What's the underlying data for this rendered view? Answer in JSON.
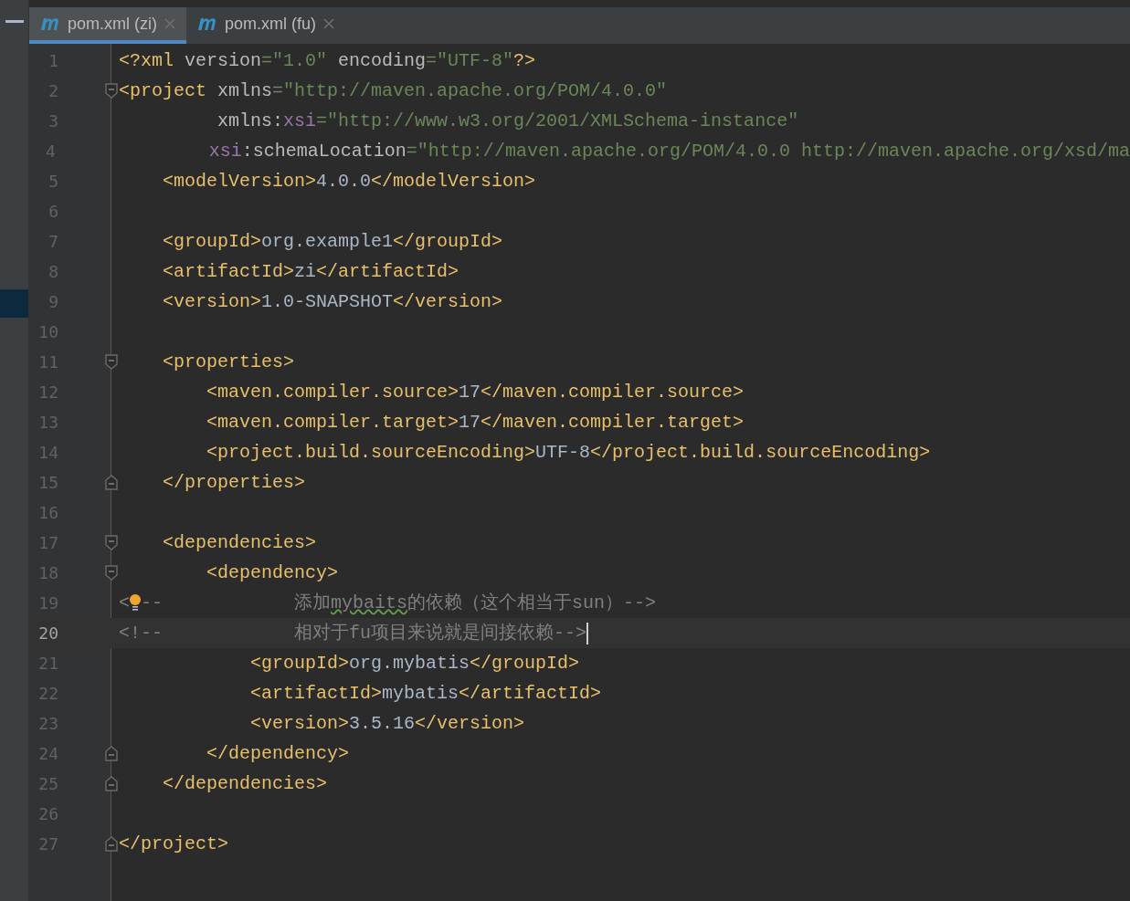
{
  "tabs": [
    {
      "label": "pom.xml (zi)",
      "selected": true
    },
    {
      "label": "pom.xml (fu)",
      "selected": false
    }
  ],
  "editor": {
    "lines": [
      {
        "number": "1",
        "current": false,
        "fold_start": false,
        "fold_end": false,
        "tokens": [
          {
            "t": "<?xml ",
            "kind": "tag"
          },
          {
            "t": "version",
            "kind": "attr"
          },
          {
            "t": "=\"1.0\" ",
            "kind": "string"
          },
          {
            "t": "encoding",
            "kind": "attr"
          },
          {
            "t": "=\"UTF-8\"",
            "kind": "string"
          },
          {
            "t": "?>",
            "kind": "tag"
          }
        ]
      },
      {
        "number": "2",
        "current": false,
        "fold_start": true,
        "fold_end": false,
        "tokens": [
          {
            "t": "<project ",
            "kind": "tag"
          },
          {
            "t": "xmlns",
            "kind": "attr"
          },
          {
            "t": "=\"http://maven.apache.org/POM/4.0.0\"",
            "kind": "string"
          }
        ]
      },
      {
        "number": "3",
        "current": false,
        "fold_start": false,
        "fold_end": false,
        "tokens": [
          {
            "t": "         xmlns:",
            "kind": "attr"
          },
          {
            "t": "xsi",
            "kind": "ns"
          },
          {
            "t": "=\"http://www.w3.org/2001/XMLSchema-instance\"",
            "kind": "string"
          }
        ]
      },
      {
        "number": "4",
        "current": false,
        "fold_start": false,
        "fold_end": false,
        "tokens": [
          {
            "t": "         xsi",
            "kind": "ns"
          },
          {
            "t": ":schemaLocation",
            "kind": "attr"
          },
          {
            "t": "=\"http://maven.apache.org/POM/4.0.0 http://maven.apache.org/xsd/ma",
            "kind": "string"
          }
        ]
      },
      {
        "number": "5",
        "current": false,
        "fold_start": false,
        "fold_end": false,
        "tokens": [
          {
            "t": "    <modelVersion>",
            "kind": "tag"
          },
          {
            "t": "4.0.0",
            "kind": "text"
          },
          {
            "t": "</modelVersion>",
            "kind": "tag"
          }
        ]
      },
      {
        "number": "6",
        "current": false,
        "fold_start": false,
        "fold_end": false
      },
      {
        "number": "7",
        "current": false,
        "fold_start": false,
        "fold_end": false,
        "tokens": [
          {
            "t": "    <groupId>",
            "kind": "tag"
          },
          {
            "t": "org.example1",
            "kind": "text"
          },
          {
            "t": "</groupId>",
            "kind": "tag"
          }
        ]
      },
      {
        "number": "8",
        "current": false,
        "fold_start": false,
        "fold_end": false,
        "tokens": [
          {
            "t": "    <artifactId>",
            "kind": "tag"
          },
          {
            "t": "zi",
            "kind": "text"
          },
          {
            "t": "</artifactId>",
            "kind": "tag"
          }
        ]
      },
      {
        "number": "9",
        "current": false,
        "fold_start": false,
        "fold_end": false,
        "tokens": [
          {
            "t": "    <version>",
            "kind": "tag"
          },
          {
            "t": "1.0-SNAPSHOT",
            "kind": "text"
          },
          {
            "t": "</version>",
            "kind": "tag"
          }
        ]
      },
      {
        "number": "10",
        "current": false,
        "fold_start": false,
        "fold_end": false
      },
      {
        "number": "11",
        "current": false,
        "fold_start": true,
        "fold_end": false,
        "tokens": [
          {
            "t": "    <properties>",
            "kind": "tag"
          }
        ]
      },
      {
        "number": "12",
        "current": false,
        "fold_start": false,
        "fold_end": false,
        "tokens": [
          {
            "t": "        <maven.compiler.source>",
            "kind": "tag"
          },
          {
            "t": "17",
            "kind": "text"
          },
          {
            "t": "</maven.compiler.source>",
            "kind": "tag"
          }
        ]
      },
      {
        "number": "13",
        "current": false,
        "fold_start": false,
        "fold_end": false,
        "tokens": [
          {
            "t": "        <maven.compiler.target>",
            "kind": "tag"
          },
          {
            "t": "17",
            "kind": "text"
          },
          {
            "t": "</maven.compiler.target>",
            "kind": "tag"
          }
        ]
      },
      {
        "number": "14",
        "current": false,
        "fold_start": false,
        "fold_end": false,
        "tokens": [
          {
            "t": "        <project.build.sourceEncoding>",
            "kind": "tag"
          },
          {
            "t": "UTF-8",
            "kind": "text"
          },
          {
            "t": "</project.build.sourceEncoding>",
            "kind": "tag"
          }
        ]
      },
      {
        "number": "15",
        "current": false,
        "fold_start": false,
        "fold_end": true,
        "tokens": [
          {
            "t": "    </properties>",
            "kind": "tag"
          }
        ]
      },
      {
        "number": "16",
        "current": false,
        "fold_start": false,
        "fold_end": false
      },
      {
        "number": "17",
        "current": false,
        "fold_start": true,
        "fold_end": false,
        "tokens": [
          {
            "t": "    <dependencies>",
            "kind": "tag"
          }
        ]
      },
      {
        "number": "18",
        "current": false,
        "fold_start": true,
        "fold_end": false,
        "tokens": [
          {
            "t": "        <dependency>",
            "kind": "tag"
          }
        ]
      },
      {
        "number": "19",
        "current": false,
        "fold_start": false,
        "fold_end": false,
        "bulb": true,
        "tokens": [
          {
            "t": "<",
            "kind": "comment"
          },
          {
            "t": "--            ",
            "kind": "comment"
          },
          {
            "t": "添加",
            "kind": "comment"
          },
          {
            "t": "mybaits",
            "kind": "typo"
          },
          {
            "t": "的依赖（这个相当于sun）-->",
            "kind": "comment"
          }
        ]
      },
      {
        "number": "20",
        "current": true,
        "fold_start": false,
        "fold_end": false,
        "tokens": [
          {
            "t": "<!--            相对于fu项目来说就是间接依赖-->",
            "kind": "comment"
          }
        ]
      },
      {
        "number": "21",
        "current": false,
        "fold_start": false,
        "fold_end": false,
        "tokens": [
          {
            "t": "            <groupId>",
            "kind": "tag"
          },
          {
            "t": "org.mybatis",
            "kind": "text"
          },
          {
            "t": "</groupId>",
            "kind": "tag"
          }
        ]
      },
      {
        "number": "22",
        "current": false,
        "fold_start": false,
        "fold_end": false,
        "tokens": [
          {
            "t": "            <artifactId>",
            "kind": "tag"
          },
          {
            "t": "mybatis",
            "kind": "text"
          },
          {
            "t": "</artifactId>",
            "kind": "tag"
          }
        ]
      },
      {
        "number": "23",
        "current": false,
        "fold_start": false,
        "fold_end": false,
        "tokens": [
          {
            "t": "            <version>",
            "kind": "tag"
          },
          {
            "t": "3.5.16",
            "kind": "text"
          },
          {
            "t": "</version>",
            "kind": "tag"
          }
        ]
      },
      {
        "number": "24",
        "current": false,
        "fold_start": false,
        "fold_end": true,
        "tokens": [
          {
            "t": "        </dependency>",
            "kind": "tag"
          }
        ]
      },
      {
        "number": "25",
        "current": false,
        "fold_start": false,
        "fold_end": true,
        "tokens": [
          {
            "t": "    </dependencies>",
            "kind": "tag"
          }
        ]
      },
      {
        "number": "26",
        "current": false,
        "fold_start": false,
        "fold_end": false
      },
      {
        "number": "27",
        "current": false,
        "fold_start": false,
        "fold_end": true,
        "tokens": [
          {
            "t": "</project>",
            "kind": "tag"
          }
        ]
      }
    ]
  }
}
